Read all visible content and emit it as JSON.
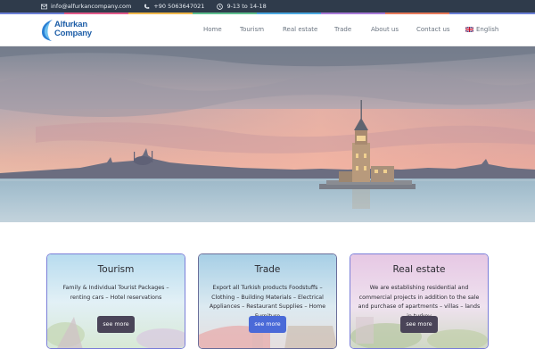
{
  "topbar": {
    "email": "info@alfurkancompany.com",
    "phone": "+90 5063647021",
    "hours": "9-13 to 14-18"
  },
  "logo": {
    "line1": "Alfurkan",
    "line2": "Company"
  },
  "nav": {
    "items": [
      "Home",
      "Tourism",
      "Real estate",
      "Trade",
      "About us",
      "Contact us"
    ],
    "language": "English"
  },
  "cards": [
    {
      "title": "Tourism",
      "description": "Family & Individual Tourist Packages – renting cars – Hotel reservations",
      "button": "see more"
    },
    {
      "title": "Trade",
      "description": "Export all Turkish products Foodstuffs – Clothing – Building Materials – Electrical Appliances – Restaurant Supplies – Home Furniture",
      "button": "see more"
    },
    {
      "title": "Real estate",
      "description": "We are establishing residential and commercial projects in addition to the sale and purchase of apartments – villas – lands in turkey",
      "button": "see more"
    }
  ],
  "colors": {
    "topbar": "#2f3b4b",
    "brand": "#1f5fa8",
    "card_border": "#7a7ed8",
    "button_dark": "#4a4458",
    "button_blue": "#4a6ad8"
  }
}
